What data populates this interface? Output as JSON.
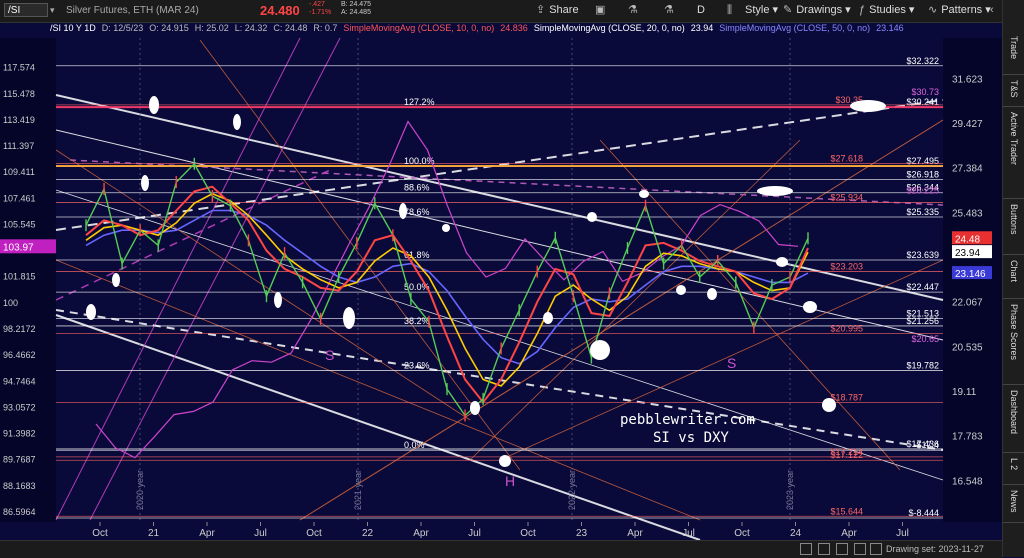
{
  "toolbar": {
    "symbol": "/SI",
    "description": "Silver Futures, ETH (MAR 24)",
    "last": "24.480",
    "change": "-.427",
    "change_pct": "-1.71%",
    "bid": "B: 24.475",
    "ask": "A: 24.485",
    "share_label": "Share",
    "aggregation": "D",
    "style_label": "Style",
    "drawings_label": "Drawings",
    "studies_label": "Studies",
    "patterns_label": "Patterns"
  },
  "infobar": {
    "items": [
      {
        "text": "/SI 10 Y 1D",
        "color": "#ffffff"
      },
      {
        "text": "D: 12/5/23",
        "color": "#bbbbbb"
      },
      {
        "text": "O: 24.915",
        "color": "#bbbbbb"
      },
      {
        "text": "H: 25.02",
        "color": "#bbbbbb"
      },
      {
        "text": "L: 24.32",
        "color": "#bbbbbb"
      },
      {
        "text": "C: 24.48",
        "color": "#bbbbbb"
      },
      {
        "text": "R: 0.7",
        "color": "#bbbbbb"
      },
      {
        "text": "SimpleMovingAvg (CLOSE, 10, 0, no)",
        "color": "#ff5555"
      },
      {
        "text": "24.836",
        "color": "#ff5555"
      },
      {
        "text": "SimpleMovingAvg (CLOSE, 20, 0, no)",
        "color": "#ffffff"
      },
      {
        "text": "23.94",
        "color": "#ffffff"
      },
      {
        "text": "SimpleMovingAvg (CLOSE, 50, 0, no)",
        "color": "#8888ff"
      },
      {
        "text": "23.146",
        "color": "#8888ff"
      }
    ]
  },
  "right_tabs": [
    "Trade",
    "T&S",
    "Active Trader",
    "Buttons",
    "Chart",
    "Phase Scores",
    "Dashboard",
    "L 2",
    "News"
  ],
  "bottom": {
    "drawing_set": "Drawing set: 2023-11-27"
  },
  "colors": {
    "background": "#0a0a3a",
    "silver_price": "#55cc55",
    "sma10": "#ff4444",
    "sma20": "#ffcc00",
    "sma50": "#6666ff",
    "dxy": "#cc44cc",
    "trend": "#ffffff",
    "fib": "#ffffff",
    "fib_dxy": "#ff6666"
  },
  "chart_data": {
    "type": "line",
    "title": "pebblewriter.com SI vs DXY",
    "xlabel": "",
    "ylabel": "",
    "left_axis_ticks": [
      {
        "label": "117.574",
        "v": 117.574
      },
      {
        "label": "115.478",
        "v": 115.478
      },
      {
        "label": "113.419",
        "v": 113.419
      },
      {
        "label": "111.397",
        "v": 111.397
      },
      {
        "label": "109.411",
        "v": 109.411
      },
      {
        "label": "107.461",
        "v": 107.461
      },
      {
        "label": "105.545",
        "v": 105.545
      },
      {
        "label": "101.815",
        "v": 101.815
      },
      {
        "label": "100",
        "v": 100
      },
      {
        "label": "98.2172",
        "v": 98.2172
      },
      {
        "label": "96.4662",
        "v": 96.4662
      },
      {
        "label": "94.7464",
        "v": 94.7464
      },
      {
        "label": "93.0572",
        "v": 93.0572
      },
      {
        "label": "91.3982",
        "v": 91.3982
      },
      {
        "label": "89.7687",
        "v": 89.7687
      },
      {
        "label": "88.1683",
        "v": 88.1683
      },
      {
        "label": "86.5964",
        "v": 86.5964
      }
    ],
    "left_axis_current": "103.97",
    "right_axis_ticks": [
      {
        "label": "31.623",
        "v": 31.623
      },
      {
        "label": "29.427",
        "v": 29.427
      },
      {
        "label": "27.384",
        "v": 27.384
      },
      {
        "label": "25.483",
        "v": 25.483
      },
      {
        "label": "22.067",
        "v": 22.067
      },
      {
        "label": "20.535",
        "v": 20.535
      },
      {
        "label": "19.11",
        "v": 19.11
      },
      {
        "label": "17.783",
        "v": 17.783
      },
      {
        "label": "16.548",
        "v": 16.548
      }
    ],
    "right_axis_badges": [
      {
        "label": "24.48",
        "v": 24.48,
        "bg": "#e83030",
        "fg": "#ffffff"
      },
      {
        "label": "23.94",
        "v": 23.94,
        "bg": "#ffffff",
        "fg": "#000000"
      },
      {
        "label": "23.146",
        "v": 23.146,
        "bg": "#3a3ad8",
        "fg": "#ffffff"
      }
    ],
    "x_ticks": [
      "Oct",
      "21",
      "Apr",
      "Jul",
      "Oct",
      "22",
      "Apr",
      "Jul",
      "Oct",
      "23",
      "Apr",
      "Jul",
      "Oct",
      "24",
      "Apr",
      "Jul"
    ],
    "year_marks": [
      "2020 year",
      "2021 year",
      "2022 year",
      "2023 year"
    ],
    "fib_labels": [
      {
        "text": "127.2%",
        "v": 30.241
      },
      {
        "text": "100.0%",
        "v": 27.495
      },
      {
        "text": "88.6%",
        "v": 26.344
      },
      {
        "text": "78.6%",
        "v": 25.335
      },
      {
        "text": "61.8%",
        "v": 23.639
      },
      {
        "text": "50.0%",
        "v": 22.447
      },
      {
        "text": "38.2%",
        "v": 21.256
      },
      {
        "text": "23.6%",
        "v": 19.782
      },
      {
        "text": "0.0%",
        "v": 17.4
      }
    ],
    "price_levels_white": [
      {
        "label": "$32.322",
        "v": 32.322
      },
      {
        "label": "$30.241",
        "v": 30.241
      },
      {
        "label": "$27.495",
        "v": 27.495
      },
      {
        "label": "$26.918",
        "v": 26.918
      },
      {
        "label": "$26.344",
        "v": 26.344
      },
      {
        "label": "$25.335",
        "v": 25.335
      },
      {
        "label": "$23.639",
        "v": 23.639
      },
      {
        "label": "$22.447",
        "v": 22.447
      },
      {
        "label": "$21.513",
        "v": 21.513
      },
      {
        "label": "$21.256",
        "v": 21.256
      },
      {
        "label": "$19.782",
        "v": 19.782
      },
      {
        "label": "$17.4",
        "v": 17.4
      },
      {
        "label": "$17.436",
        "v": 17.436
      },
      {
        "label": "$-8.444",
        "v": 15.6
      }
    ],
    "price_levels_red": [
      {
        "label": "$30.35",
        "v": 30.35
      },
      {
        "label": "$27.618",
        "v": 27.618
      },
      {
        "label": "$25.934",
        "v": 25.934
      },
      {
        "label": "$23.203",
        "v": 23.203
      },
      {
        "label": "$20.995",
        "v": 21.0
      },
      {
        "label": "$18.787",
        "v": 18.787
      },
      {
        "label": "$17.122",
        "v": 17.122
      },
      {
        "label": "$17.214",
        "v": 17.214
      },
      {
        "label": "$15.644",
        "v": 15.644
      }
    ],
    "price_levels_magenta": [
      {
        "label": "$30.73",
        "v": 30.73
      },
      {
        "label": "$26.225",
        "v": 26.225
      },
      {
        "label": "$20.65",
        "v": 20.65
      }
    ],
    "annotations": [
      {
        "text": "pebblewriter.com"
      },
      {
        "text": "SI vs DXY"
      },
      {
        "text": "S"
      },
      {
        "text": "S"
      },
      {
        "text": "H"
      }
    ],
    "silver_close": [
      25.0,
      26.5,
      23.5,
      24.8,
      24.2,
      26.8,
      27.6,
      26.2,
      25.8,
      24.4,
      22.3,
      23.9,
      22.8,
      21.5,
      23.0,
      24.3,
      25.9,
      24.6,
      22.2,
      21.4,
      19.2,
      18.4,
      18.9,
      20.5,
      21.8,
      23.2,
      24.5,
      22.3,
      20.2,
      22.4,
      24.1,
      25.8,
      23.5,
      24.2,
      23.0,
      23.6,
      22.8,
      21.2,
      22.7,
      23.0,
      24.48
    ],
    "sma10": [
      24.6,
      25.2,
      25.0,
      24.6,
      24.8,
      25.6,
      26.4,
      26.6,
      25.9,
      25.2,
      24.0,
      23.3,
      23.0,
      22.6,
      22.5,
      23.2,
      24.4,
      24.6,
      23.6,
      22.5,
      20.9,
      19.5,
      18.8,
      19.5,
      20.7,
      22.1,
      23.3,
      23.1,
      21.7,
      21.6,
      22.8,
      24.2,
      24.3,
      24.0,
      23.6,
      23.4,
      23.2,
      22.4,
      22.2,
      22.6,
      24.1
    ],
    "sma20": [
      24.4,
      24.9,
      25.0,
      24.8,
      24.6,
      25.1,
      25.9,
      26.3,
      26.0,
      25.4,
      24.6,
      23.8,
      23.3,
      22.9,
      22.6,
      22.8,
      23.6,
      24.1,
      23.8,
      23.0,
      21.8,
      20.5,
      19.5,
      19.3,
      19.9,
      21.0,
      22.3,
      22.7,
      22.2,
      21.8,
      22.3,
      23.4,
      23.9,
      23.8,
      23.5,
      23.3,
      23.2,
      22.8,
      22.5,
      22.6,
      23.94
    ],
    "sma50": [
      24.2,
      24.6,
      24.8,
      24.8,
      24.7,
      24.8,
      25.2,
      25.6,
      25.6,
      25.4,
      25.0,
      24.4,
      23.9,
      23.4,
      23.0,
      22.8,
      23.0,
      23.4,
      23.5,
      23.2,
      22.5,
      21.6,
      20.8,
      20.2,
      20.0,
      20.4,
      21.2,
      21.9,
      22.2,
      22.1,
      22.2,
      22.7,
      23.2,
      23.4,
      23.4,
      23.3,
      23.2,
      23.0,
      22.8,
      22.8,
      23.146
    ],
    "dxy_close": [
      92.0,
      90.5,
      89.9,
      91.2,
      92.6,
      92.8,
      93.4,
      95.5,
      96.1,
      96.0,
      96.6,
      98.8,
      101.5,
      104.2,
      106.8,
      109.8,
      113.3,
      111.1,
      107.0,
      103.5,
      101.8,
      102.4,
      104.5,
      103.0,
      101.6,
      102.9,
      103.6,
      101.5,
      102.1,
      103.2,
      104.0,
      106.2,
      107.0,
      106.5,
      105.8,
      104.1,
      103.97
    ],
    "legend": "none",
    "grid": false
  }
}
